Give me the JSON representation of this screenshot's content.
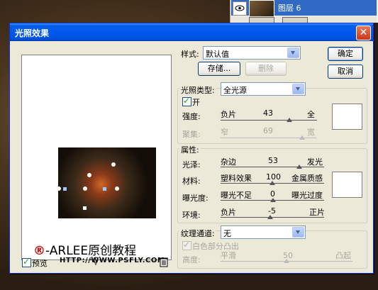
{
  "background": {
    "layers_panel": {
      "layer_name": "图层 6"
    }
  },
  "dialog": {
    "title": "光照效果",
    "style": {
      "label": "样式:",
      "value": "默认值",
      "save_label": "存储...",
      "delete_label": "删除"
    },
    "ok_label": "确定",
    "cancel_label": "取消",
    "light_type": {
      "label": "光照类型:",
      "value": "全光源",
      "on_label": "开",
      "on_checked": true,
      "intensity": {
        "label": "强度:",
        "left": "负片",
        "value": "43",
        "right": "全",
        "level_percent": 71.5
      },
      "focus": {
        "label": "聚集:",
        "left": "窄",
        "value": "69",
        "right": "宽",
        "level_percent": 84.5
      }
    },
    "properties": {
      "label": "属性:",
      "gloss": {
        "label": "光泽:",
        "left": "杂边",
        "value": "53",
        "right": "发光",
        "level_percent": 76.5
      },
      "material": {
        "label": "材料:",
        "left": "塑料效果",
        "value": "100",
        "right": "金属质感",
        "level_percent": 100
      },
      "exposure": {
        "label": "曝光度:",
        "left": "曝光不足",
        "value": "0",
        "right": "曝光过度",
        "level_percent": 50
      },
      "ambience": {
        "label": "环境:",
        "left": "负片",
        "value": "-5",
        "right": "正片",
        "level_percent": 47.5
      }
    },
    "texture": {
      "label": "纹理通道:",
      "value": "无",
      "white_high_label": "白色部分凸出",
      "white_high_checked": true,
      "height": {
        "label": "高度:",
        "left": "平滑",
        "value": "50",
        "right": "凸起",
        "level_percent": 50
      }
    },
    "preview_label": "预览",
    "preview_checked": true,
    "watermark": {
      "mark": "®",
      "line1": "-ARLEE原创教程",
      "line2": "HTTP://WWW.PSFLY.COM"
    },
    "icons": [
      "eye-icon",
      "lightbulb-icon",
      "trash-icon",
      "close-icon"
    ]
  }
}
